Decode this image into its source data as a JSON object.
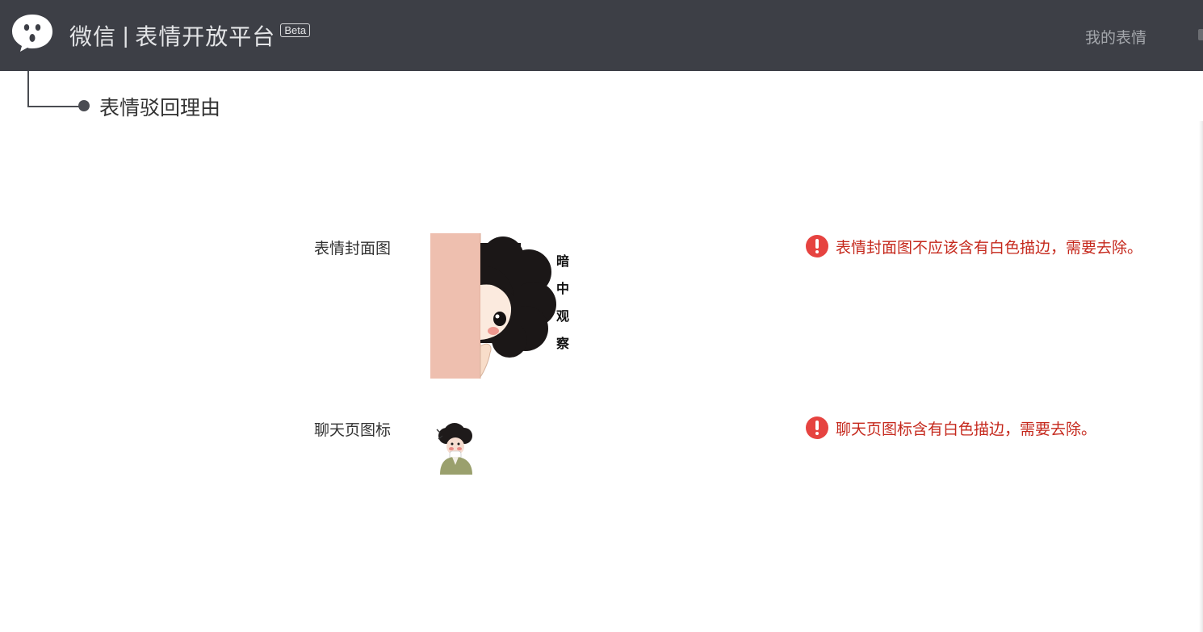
{
  "header": {
    "brand_name": "微信",
    "brand_separator": "|",
    "brand_subtitle": "表情开放平台",
    "beta_badge": "Beta",
    "nav_my_stickers": "我的表情",
    "background_color": "#3d3f46",
    "logo_icon": "wechat-speech-bubble-icon"
  },
  "section": {
    "title": "表情驳回理由"
  },
  "rows": [
    {
      "label": "表情封面图",
      "image_caption": "暗中观察",
      "error_icon": "exclamation-circle-icon",
      "error_text": "表情封面图不应该含有白色描边，需要去除。"
    },
    {
      "label": "聊天页图标",
      "error_icon": "exclamation-circle-icon",
      "error_text": "聊天页图标含有白色描边，需要去除。"
    }
  ],
  "colors": {
    "error_red": "#e64340",
    "error_text": "#c5281c",
    "header_bg": "#3d3f46"
  }
}
